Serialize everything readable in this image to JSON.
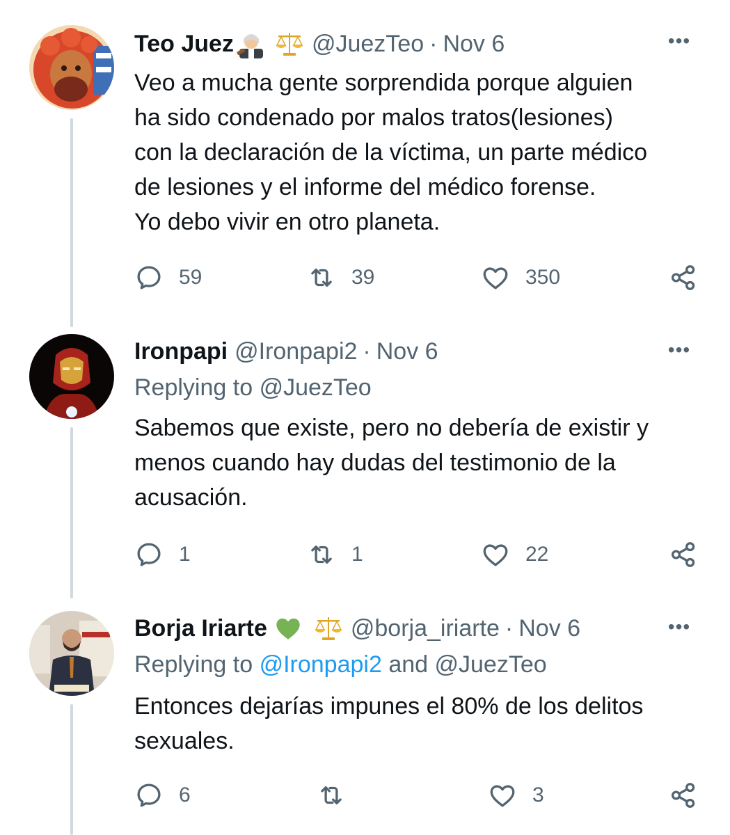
{
  "tweets": [
    {
      "name": "Teo Juez",
      "handle": "@JuezTeo",
      "separator": "·",
      "date": "Nov 6",
      "emojis": [
        "judge-emoji",
        "scales-emoji"
      ],
      "replying_prefix": "",
      "text_lines": [
        "Veo a mucha gente sorprendida porque alguien",
        "ha sido condenado por malos tratos(lesiones)",
        "con la declaración de la víctima, un parte médico",
        "de lesiones y el informe del médico forense.",
        "Yo debo vivir en otro planeta."
      ],
      "replies": "59",
      "retweets": "39",
      "likes": "350"
    },
    {
      "name": "Ironpapi",
      "handle": "@Ironpapi2",
      "separator": "·",
      "date": "Nov 6",
      "replying_prefix": "Replying to",
      "replying_to": "@JuezTeo",
      "text_lines": [
        "Sabemos que existe, pero no debería de existir y",
        "menos cuando hay dudas del testimonio de la",
        "acusación."
      ],
      "replies": "1",
      "retweets": "1",
      "likes": "22"
    },
    {
      "name": "Borja Iriarte",
      "handle": "@borja_iriarte",
      "separator": "·",
      "date": "Nov 6",
      "emojis": [
        "green-heart-emoji",
        "scales-emoji"
      ],
      "replying_prefix": "Replying to",
      "replying_to_link": "@Ironpapi2",
      "replying_and": "and",
      "replying_to": "@JuezTeo",
      "text_lines": [
        "Entonces dejarías impunes el 80% de los delitos",
        "sexuales."
      ],
      "replies": "6",
      "retweets": "",
      "likes": "3"
    }
  ],
  "more_label": "•••",
  "colors": {
    "text": "#0f1419",
    "secondary": "#536471",
    "link": "#1d9bf0",
    "thread_line": "#cfd9de",
    "green_heart": "#77b255"
  }
}
